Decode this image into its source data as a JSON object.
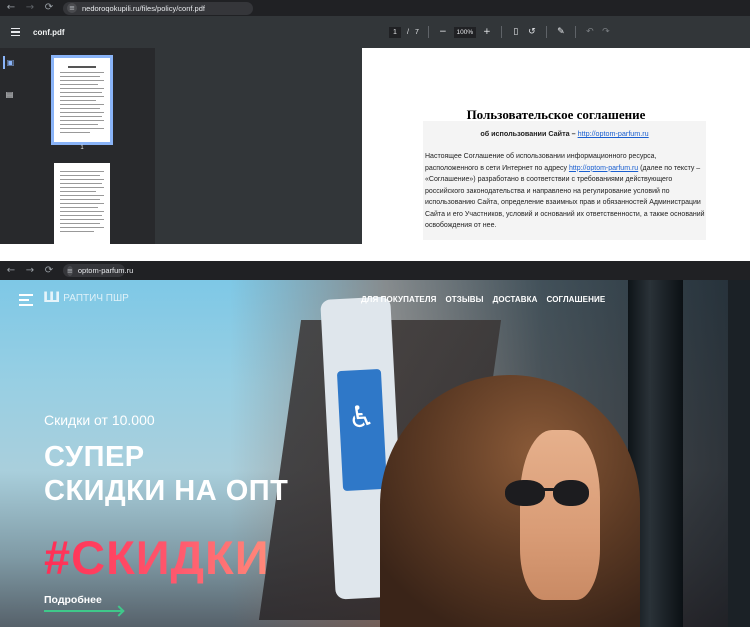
{
  "window1": {
    "browser": {
      "url": "nedoroqokupili.ru/files/policy/conf.pdf",
      "back_icon": "arrow-left-icon",
      "forward_icon": "arrow-right-icon",
      "reload_icon": "reload-icon"
    },
    "pdf_toolbar": {
      "file_name": "conf.pdf",
      "current_page": "1",
      "page_separator": "/",
      "total_pages": "7",
      "zoom_minus": "−",
      "zoom_level": "100%",
      "zoom_plus": "+"
    },
    "thumbnails": {
      "page_label": "1"
    },
    "document": {
      "title": "Пользовательское соглашение",
      "subtitle_prefix": "об использовании Сайта – ",
      "subtitle_link": "http://optom-parfum.ru",
      "body_before_link": "Настоящее Соглашение об использовании информационного ресурса, расположенного в сети Интернет по адресу ",
      "body_link": "http://optom-parfum.ru",
      "body_after_link": " (далее по тексту – «Соглашение») разработано в соответствии с требованиями действующего российского законодательства и направлено на регулирование условий по использованию Сайта, определение взаимных прав и обязанностей Администрации Сайта и его Участников, условий и оснований их ответственности, а также оснований освобождения от нее."
    }
  },
  "window2": {
    "browser": {
      "url": "optom-parfum.ru"
    },
    "site": {
      "logo_text": "РАПТИЧ ПШР",
      "nav": [
        "ДЛЯ ПОКУПАТЕЛЯ",
        "ОТЗЫВЫ",
        "ДОСТАВКА",
        "СОГЛАШЕНИЕ"
      ],
      "hero_small": "Скидки от 10.000",
      "hero_line1": "СУПЕР",
      "hero_line2": "СКИДКИ НА ОПТ",
      "hero_tag": "#СКИДКИ",
      "more_link": "Подробнее"
    }
  },
  "colors": {
    "accent_pink": "#ff2e55",
    "accent_green": "#3fc88a",
    "link_blue": "#1a5fd0",
    "pdf_toolbar": "#323639"
  }
}
